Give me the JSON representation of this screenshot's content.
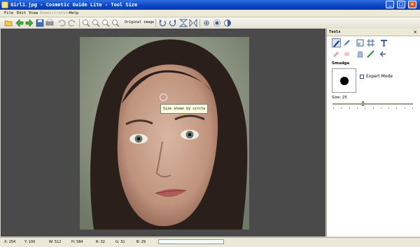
{
  "window": {
    "title": "Girl1.jpg - Cosmetic Guide Lite - Tool Size",
    "controls": [
      "_",
      "□",
      "×"
    ]
  },
  "menu": {
    "items": [
      {
        "label": "File",
        "enabled": true
      },
      {
        "label": "Edit",
        "enabled": true
      },
      {
        "label": "View",
        "enabled": true
      },
      {
        "label": "Demonstration",
        "enabled": false
      },
      {
        "label": "Help",
        "enabled": true
      }
    ]
  },
  "toolbar": {
    "original_image_label": "Original image",
    "icons": [
      "open-icon",
      "back-icon",
      "forward-icon",
      "save-icon",
      "print-icon",
      "undo-icon",
      "redo-icon",
      "zoom-in-icon",
      "zoom-out-icon",
      "zoom-fit-icon",
      "zoom-actual-icon",
      "rotate-left-icon",
      "rotate-right-icon",
      "flip-vertical-icon",
      "flip-horizontal-icon",
      "gear-icon",
      "brightness-icon",
      "contrast-icon"
    ]
  },
  "canvas": {
    "tooltip": "Size shown by circle"
  },
  "tools_panel": {
    "title": "Tools",
    "close": "×",
    "tools_row1": [
      "brush-tool-icon",
      "eraser-brush-icon",
      "crop-icon",
      "grid-icon",
      "text-tool-icon"
    ],
    "tools_row2": [
      "lipstick-icon",
      "blush-icon",
      "foundation-icon",
      "eyeliner-icon",
      "undo-stroke-icon"
    ],
    "section": "Smudge",
    "expert_mode_label": "Expert Mode",
    "expert_mode_checked": false,
    "size_label": "Size: 25",
    "size_value": 25
  },
  "statusbar": {
    "x": "X: 254",
    "y": "Y: 100",
    "w": "W: 512",
    "h": "H: 584",
    "r": "R: 32",
    "g": "G: 31",
    "b": "B: 29",
    "progress_fraction": 0
  },
  "colors": {
    "titlebar": "#0a45c6",
    "canvas_bg": "#4a4a4a",
    "tooltip_bg": "#ffffe1"
  }
}
